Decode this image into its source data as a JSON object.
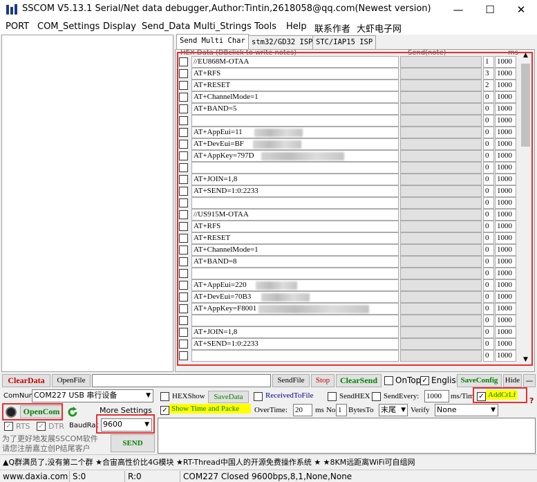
{
  "window": {
    "title": "SSCOM V5.13.1 Serial/Net data debugger,Author:Tintin,2618058@qq.com(Newest version)",
    "minimize": "—",
    "maximize": "☐",
    "close": "✕"
  },
  "menu": [
    "PORT",
    "COM_Settings",
    "Display",
    "Send_Data",
    "Multi_Strings",
    "Tools",
    "Help",
    "联系作者",
    "大虾电子网"
  ],
  "tabs": [
    "Send Multi Char",
    "stm32/GD32 ISP",
    "STC/IAP15 ISP"
  ],
  "table_header": {
    "left": "HEX  Data (DBclick to write notes)",
    "right": "Send(note)",
    "ms": "ms"
  },
  "rows": [
    {
      "text": "//EU868M-OTAA",
      "n": "1",
      "ms": "1000"
    },
    {
      "text": "AT+RFS",
      "n": "3",
      "ms": "1000"
    },
    {
      "text": "AT+RESET",
      "n": "2",
      "ms": "1000"
    },
    {
      "text": "AT+ChannelMode=1",
      "n": "0",
      "ms": "1000"
    },
    {
      "text": "AT+BAND=5",
      "n": "0",
      "ms": "1000"
    },
    {
      "text": "",
      "n": "0",
      "ms": "1000"
    },
    {
      "text": "AT+AppEui=11",
      "n": "0",
      "ms": "1000"
    },
    {
      "text": "AT+DevEui=BF",
      "n": "0",
      "ms": "1000"
    },
    {
      "text": "AT+AppKey=797D",
      "n": "0",
      "ms": "1000"
    },
    {
      "text": "",
      "n": "0",
      "ms": "1000"
    },
    {
      "text": "AT+JOIN=1,8",
      "n": "0",
      "ms": "1000"
    },
    {
      "text": "AT+SEND=1:0:2233",
      "n": "0",
      "ms": "1000"
    },
    {
      "text": "",
      "n": "0",
      "ms": "1000"
    },
    {
      "text": "//US915M-OTAA",
      "n": "0",
      "ms": "1000"
    },
    {
      "text": "AT+RFS",
      "n": "0",
      "ms": "1000"
    },
    {
      "text": "AT+RESET",
      "n": "0",
      "ms": "1000"
    },
    {
      "text": "AT+ChannelMode=1",
      "n": "0",
      "ms": "1000"
    },
    {
      "text": "AT+BAND=8",
      "n": "0",
      "ms": "1000"
    },
    {
      "text": "",
      "n": "0",
      "ms": "1000"
    },
    {
      "text": "AT+AppEui=220",
      "n": "0",
      "ms": "1000"
    },
    {
      "text": "AT+DevEui=70B3",
      "n": "0",
      "ms": "1000"
    },
    {
      "text": "AT+AppKey=F8001",
      "n": "0",
      "ms": "1000"
    },
    {
      "text": "",
      "n": "0",
      "ms": "1000"
    },
    {
      "text": "AT+JOIN=1,8",
      "n": "0",
      "ms": "1000"
    },
    {
      "text": "AT+SEND=1:0:2233",
      "n": "0",
      "ms": "1000"
    },
    {
      "text": "",
      "n": "0",
      "ms": "1000"
    }
  ],
  "toolbar": {
    "clear_data": "ClearData",
    "open_file": "OpenFile",
    "send_file": "SendFile",
    "stop": "Stop",
    "clear_send": "ClearSend",
    "ontop": "OnTop",
    "english": "English",
    "save_config": "SaveConfig",
    "hide": "Hide"
  },
  "port": {
    "comnum_label": "ComNum",
    "comnum_value": "COM227 USB 串行设备",
    "open_com": "OpenCom",
    "more_settings": "More Settings",
    "rts": "RTS",
    "dtr": "DTR",
    "baud_label": "BaudRat",
    "baud_value": "9600"
  },
  "options": {
    "hexshow": "HEXShow",
    "savedata": "SaveData",
    "received_to_file": "ReceivedToFile",
    "sendhex": "SendHEX",
    "send_every": "SendEvery:",
    "send_every_value": "1000",
    "ms_tim": "ms/Tim",
    "addcrlf": "AddCrLf",
    "show_time": "Show Time and Packe",
    "overtime": "OverTime:",
    "overtime_value": "20",
    "ms": "ms",
    "no": "No",
    "no_value": "1",
    "bytes_to": "BytesTo",
    "bytes_to_value": "末尾",
    "verify": "Verify",
    "verify_value": "None"
  },
  "promo": "为了更好地发展SSCOM软件\n请您注册嘉立创P结尾客户",
  "send_button": "SEND",
  "ticker": "▲Q群满员了,没有第二个群 ★合宙高性价比4G模块 ★RT-Thread中国人的开源免费操作系统 ★ ★8KM远距离WiFi可自组网",
  "status": {
    "site": "www.daxia.com",
    "sent": "S:0",
    "recv": "R:0",
    "port_status": "COM227 Closed  9600bps,8,1,None,None"
  },
  "colors": {
    "red_highlight": "#e53030",
    "clear_red": "#c00000",
    "green": "#008000",
    "yellow": "#ffff00"
  }
}
